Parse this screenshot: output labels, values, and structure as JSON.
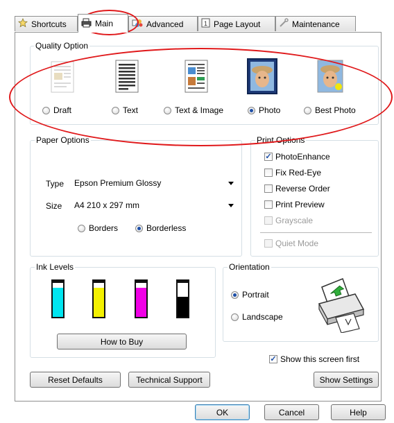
{
  "tabs": [
    {
      "label": "Shortcuts",
      "icon": "star-icon"
    },
    {
      "label": "Main",
      "icon": "printer-icon"
    },
    {
      "label": "Advanced",
      "icon": "advanced-icon"
    },
    {
      "label": "Page Layout",
      "icon": "page-layout-icon"
    },
    {
      "label": "Maintenance",
      "icon": "wrench-icon"
    }
  ],
  "quality": {
    "title": "Quality Option",
    "options": [
      {
        "label": "Draft",
        "selected": false
      },
      {
        "label": "Text",
        "selected": false
      },
      {
        "label": "Text & Image",
        "selected": false
      },
      {
        "label": "Photo",
        "selected": true
      },
      {
        "label": "Best Photo",
        "selected": false
      }
    ]
  },
  "paper": {
    "title": "Paper Options",
    "type_label": "Type",
    "type_value": "Epson Premium Glossy",
    "size_label": "Size",
    "size_value": "A4 210 x 297 mm",
    "borders_label": "Borders",
    "borderless_label": "Borderless",
    "borderless_selected": true
  },
  "print_options": {
    "title": "Print Options",
    "items": [
      {
        "label": "PhotoEnhance",
        "checked": true,
        "enabled": true
      },
      {
        "label": "Fix Red-Eye",
        "checked": false,
        "enabled": true
      },
      {
        "label": "Reverse Order",
        "checked": false,
        "enabled": true
      },
      {
        "label": "Print Preview",
        "checked": false,
        "enabled": true
      },
      {
        "label": "Grayscale",
        "checked": false,
        "enabled": false
      }
    ],
    "quiet_mode": {
      "label": "Quiet Mode",
      "checked": false,
      "enabled": false
    }
  },
  "ink": {
    "title": "Ink Levels",
    "cartridges": [
      {
        "color": "#00e5f0",
        "level": 0.85
      },
      {
        "color": "#f3f000",
        "level": 0.85
      },
      {
        "color": "#f000e6",
        "level": 0.85
      },
      {
        "color": "#000000",
        "level": 0.6
      }
    ],
    "how_to_buy": "How to Buy"
  },
  "orientation": {
    "title": "Orientation",
    "portrait": "Portrait",
    "landscape": "Landscape",
    "portrait_selected": true
  },
  "show_first": {
    "label": "Show this screen first",
    "checked": true
  },
  "buttons": {
    "reset": "Reset Defaults",
    "support": "Technical Support",
    "settings": "Show Settings",
    "ok": "OK",
    "cancel": "Cancel",
    "help": "Help"
  },
  "colors": {
    "annotation": "#e0191b",
    "accent": "#1d4fa8"
  }
}
